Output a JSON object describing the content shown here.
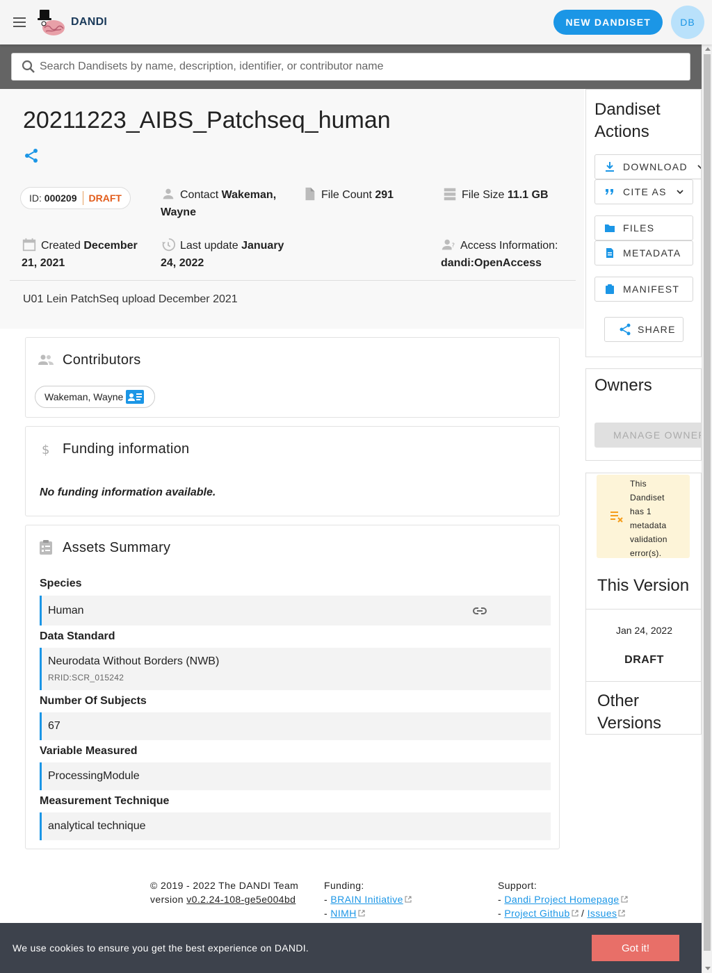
{
  "header": {
    "brand": "DANDI",
    "new_dandiset_label": "NEW DANDISET",
    "avatar_initials": "DB",
    "accent": "#1b96e6"
  },
  "search": {
    "placeholder": "Search Dandisets by name, description, identifier, or contributor name",
    "value": ""
  },
  "dandiset": {
    "title": "20211223_AIBS_Patchseq_human",
    "id_label": "ID:",
    "id": "000209",
    "status": "DRAFT",
    "contact_label": "Contact",
    "contact_name_1": "Wakeman,",
    "contact_name_2": "Wayne",
    "file_count_label": "File Count",
    "file_count": "291",
    "file_size_label": "File Size",
    "file_size": "11.1 GB",
    "created_label": "Created",
    "created_1": "December",
    "created_2": "21, 2021",
    "last_update_label": "Last update",
    "last_update_1": "January",
    "last_update_2": "24, 2022",
    "access_label": "Access Information:",
    "access_value": "dandi:OpenAccess",
    "description": "U01 Lein PatchSeq upload December 2021"
  },
  "contributors": {
    "title": "Contributors",
    "items": [
      "Wakeman, Wayne"
    ]
  },
  "funding": {
    "title": "Funding information",
    "empty_text": "No funding information available."
  },
  "assets_summary": {
    "title": "Assets Summary",
    "species_label": "Species",
    "species": "Human",
    "data_standard_label": "Data Standard",
    "data_standard": "Neurodata Without Borders (NWB)",
    "data_standard_rrid": "RRID:SCR_015242",
    "subjects_label": "Number Of Subjects",
    "subjects": "67",
    "variable_label": "Variable Measured",
    "variable": "ProcessingModule",
    "technique_label": "Measurement Technique",
    "technique": "analytical technique"
  },
  "sidebar": {
    "actions_title_1": "Dandiset",
    "actions_title_2": "Actions",
    "download_label": "DOWNLOAD",
    "cite_label": "CITE AS",
    "files_label": "FILES",
    "metadata_label": "METADATA",
    "manifest_label": "MANIFEST",
    "share_label": "SHARE",
    "owners_title": "Owners",
    "manage_owners_label": "MANAGE OWNERS",
    "validation_text": "This Dandiset has 1 metadata validation error(s).",
    "this_version_title": "This Version",
    "version_date": "Jan 24, 2022",
    "version_name": "DRAFT",
    "other_versions_title_1": "Other",
    "other_versions_title_2": "Versions"
  },
  "footer": {
    "copyright": "© 2019 - 2022 The DANDI Team",
    "version_prefix": "version",
    "version": "v0.2.24-108-ge5e004bd",
    "funding_label": "Funding:",
    "funding_links": [
      "BRAIN Initiative",
      "NIMH"
    ],
    "support_label": "Support:",
    "support_homepage": "Dandi Project Homepage",
    "support_github": "Project Github",
    "support_sep": "/",
    "support_issues": "Issues"
  },
  "cookie": {
    "text": "We use cookies to ensure you get the best experience on DANDI.",
    "button": "Got it!"
  }
}
